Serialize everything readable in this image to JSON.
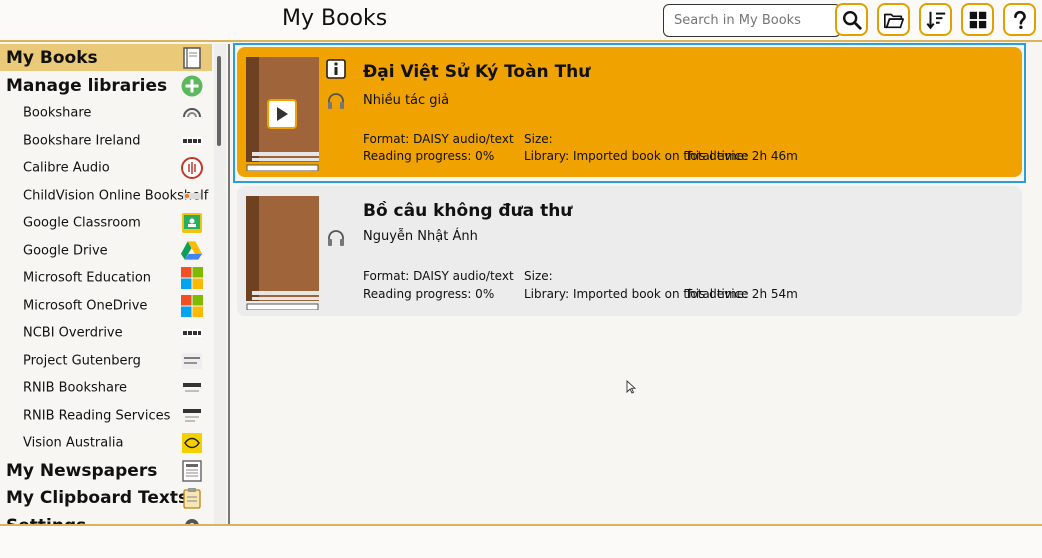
{
  "header": {
    "title": "My Books",
    "search_placeholder": "Search in My Books",
    "buttons": [
      {
        "name": "search-button",
        "icon": "magnifier-icon"
      },
      {
        "name": "open-folder-button",
        "icon": "folder-open-icon"
      },
      {
        "name": "sort-button",
        "icon": "sort-down-icon"
      },
      {
        "name": "grid-view-button",
        "icon": "grid-icon"
      },
      {
        "name": "help-button",
        "icon": "question-icon"
      }
    ]
  },
  "sidebar": {
    "items": [
      {
        "label": "My Books",
        "level": "top",
        "selected": true,
        "icon": "book-icon"
      },
      {
        "label": "Manage libraries",
        "level": "top",
        "selected": false,
        "icon": "add-circle-icon"
      },
      {
        "label": "Bookshare",
        "level": "sub",
        "icon": "bookshare-logo-icon"
      },
      {
        "label": "Bookshare Ireland",
        "level": "sub",
        "icon": "ncbi-logo-icon"
      },
      {
        "label": "Calibre Audio",
        "level": "sub",
        "icon": "calibre-logo-icon"
      },
      {
        "label": "ChildVision Online Bookshelf",
        "level": "sub",
        "icon": "childvision-logo-icon"
      },
      {
        "label": "Google Classroom",
        "level": "sub",
        "icon": "google-classroom-icon"
      },
      {
        "label": "Google Drive",
        "level": "sub",
        "icon": "google-drive-icon"
      },
      {
        "label": "Microsoft Education",
        "level": "sub",
        "icon": "microsoft-logo-icon"
      },
      {
        "label": "Microsoft OneDrive",
        "level": "sub",
        "icon": "microsoft-logo-icon"
      },
      {
        "label": "NCBI Overdrive",
        "level": "sub",
        "icon": "ncbi-logo-icon"
      },
      {
        "label": "Project Gutenberg",
        "level": "sub",
        "icon": "gutenberg-logo-icon"
      },
      {
        "label": "RNIB Bookshare",
        "level": "sub",
        "icon": "rnib-logo-icon"
      },
      {
        "label": "RNIB Reading Services",
        "level": "sub",
        "icon": "rnib-logo-icon"
      },
      {
        "label": "Vision Australia",
        "level": "sub",
        "icon": "vision-australia-logo-icon"
      },
      {
        "label": "My Newspapers",
        "level": "top",
        "selected": false,
        "icon": "newspaper-icon"
      },
      {
        "label": "My Clipboard Texts",
        "level": "top",
        "selected": false,
        "icon": "clipboard-icon"
      },
      {
        "label": "Settings",
        "level": "top",
        "selected": false,
        "icon": "settings-icon"
      }
    ]
  },
  "books": [
    {
      "title": "Đại Việt Sử Ký Toàn Thư",
      "author": "Nhiều tác giả",
      "format": "Format: DAISY audio/text",
      "progress": "Reading progress: 0%",
      "size": "Size:",
      "library": "Library: Imported book on this device",
      "total_time": "Total time: 2h 46m",
      "active": true
    },
    {
      "title": "Bồ câu không đưa thư",
      "author": "Nguyễn Nhật Ánh",
      "format": "Format: DAISY audio/text",
      "progress": "Reading progress: 0%",
      "size": "Size:",
      "library": "Library: Imported book on this device",
      "total_time": "Total time: 2h 54m",
      "active": false
    }
  ],
  "colors": {
    "accent": "#f0a200",
    "selection_border": "#2a9fd6",
    "sidebar_selected": "#eaca78",
    "book_cover": "#a0643a"
  }
}
